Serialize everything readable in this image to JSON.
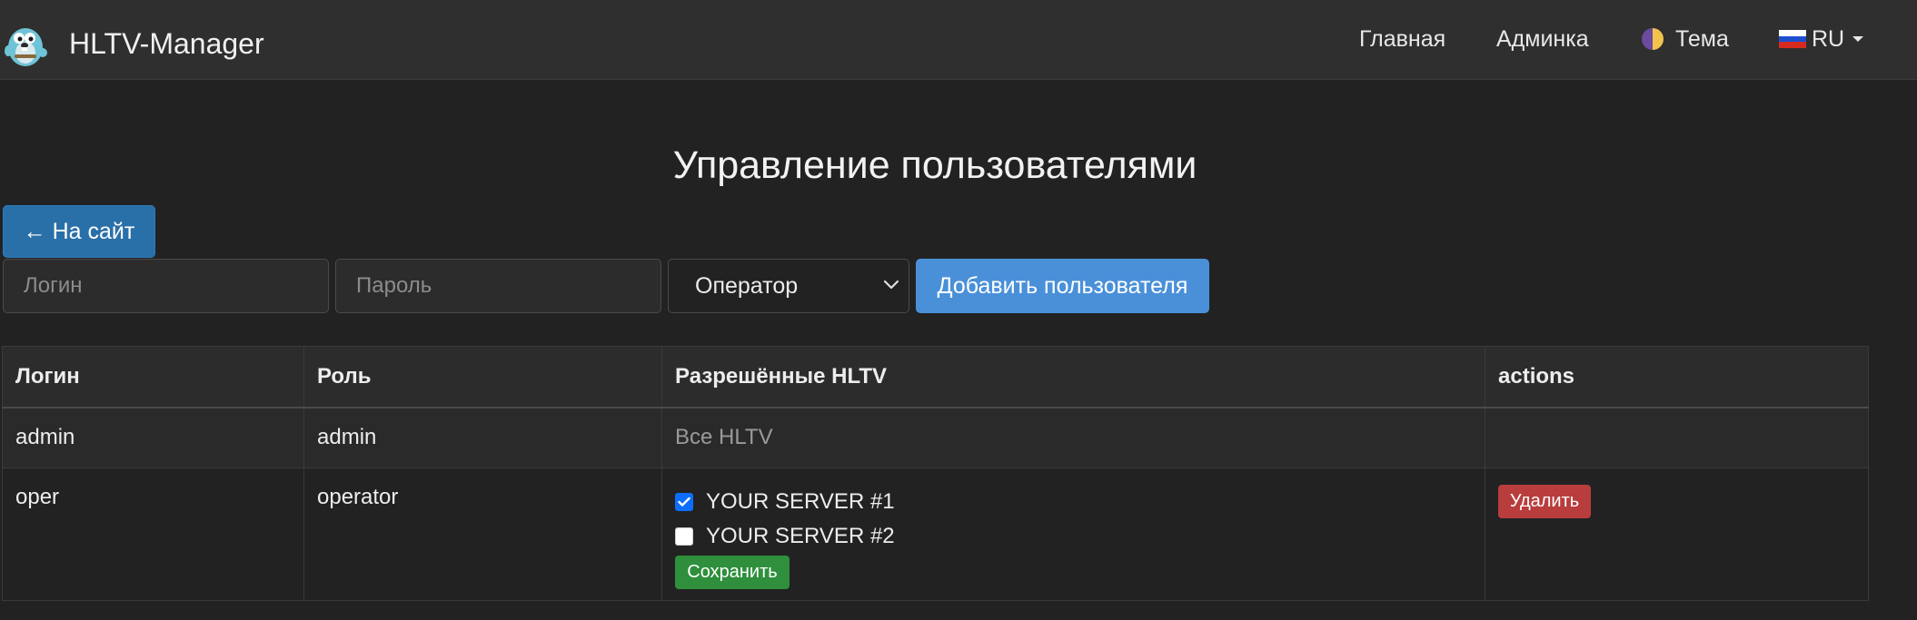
{
  "navbar": {
    "brand": "HLTV-Manager",
    "links": {
      "home": "Главная",
      "admin": "Админка",
      "theme": "Тема",
      "lang": "RU"
    }
  },
  "page": {
    "title": "Управление пользователями",
    "back_label": "← На сайт"
  },
  "form": {
    "login_placeholder": "Логин",
    "password_placeholder": "Пароль",
    "role_selected": "Оператор",
    "add_label": "Добавить пользователя"
  },
  "table": {
    "headers": [
      "Логин",
      "Роль",
      "Разрешённые HLTV",
      "actions"
    ],
    "rows": [
      {
        "login": "admin",
        "role": "admin",
        "hltv": "Все HLTV"
      },
      {
        "login": "oper",
        "role": "operator",
        "servers": [
          {
            "name": "YOUR SERVER #1",
            "checked": true
          },
          {
            "name": "YOUR SERVER #2",
            "checked": false
          }
        ],
        "save_label": "Сохранить",
        "delete_label": "Удалить"
      }
    ]
  },
  "colors": {
    "background": "#222222",
    "navbar": "#2f2f2f",
    "primary": "#4a90d9",
    "back_button": "#2a70a8",
    "success": "#2f8f3c",
    "danger": "#b93d3d"
  }
}
